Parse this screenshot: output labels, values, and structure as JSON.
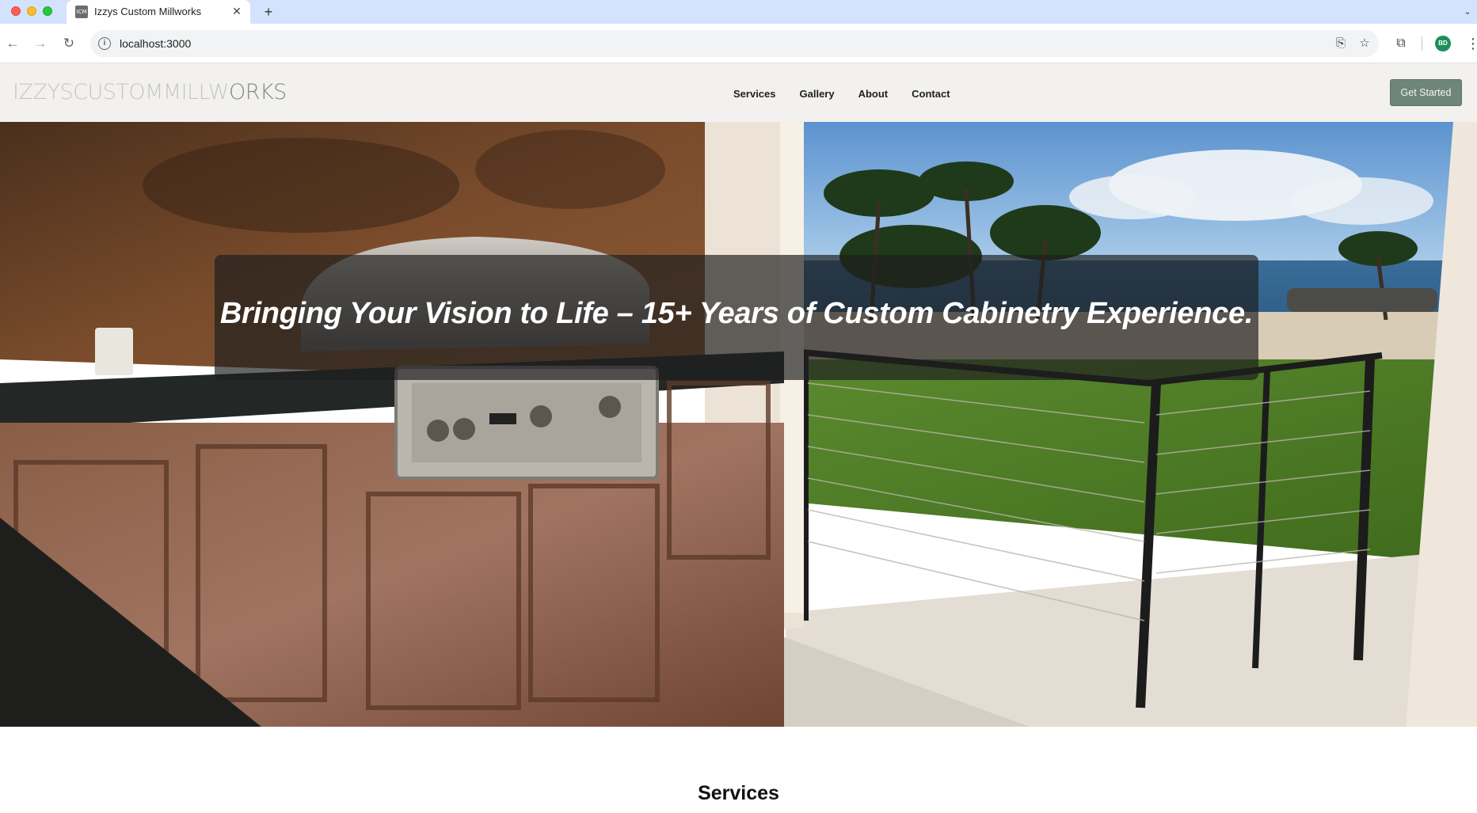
{
  "browser": {
    "tab_title": "Izzys Custom Millworks",
    "tab_favicon_text": "ICM",
    "url": "localhost:3000",
    "profile_initials": "BD",
    "icons": [
      "back-arrow-icon",
      "forward-arrow-icon",
      "reload-icon",
      "site-info-icon",
      "install-app-icon",
      "bookmark-star-icon",
      "extensions-icon",
      "kebab-menu-icon",
      "close-icon",
      "plus-icon",
      "chevron-down-icon"
    ]
  },
  "site": {
    "logo": {
      "light_part": "IZZYSCUSTOMMILLW",
      "dark_part": "ORKS"
    },
    "nav": [
      "Services",
      "Gallery",
      "About",
      "Contact"
    ],
    "cta_label": "Get Started",
    "colors": {
      "header_bg": "#f2f1ef",
      "cta_bg": "#6f857b",
      "logo_accent": "#7e8a85"
    }
  },
  "hero": {
    "headline": "Bringing Your Vision to Life – 15+ Years of Custom Cabinetry Experience."
  },
  "services": {
    "heading": "Services"
  }
}
